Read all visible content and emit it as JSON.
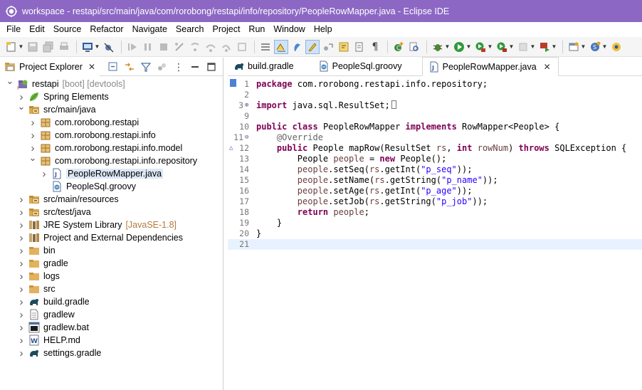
{
  "window": {
    "title": "workspace - restapi/src/main/java/com/rorobong/restapi/info/repository/PeopleRowMapper.java - Eclipse IDE"
  },
  "menu": [
    "File",
    "Edit",
    "Source",
    "Refactor",
    "Navigate",
    "Search",
    "Project",
    "Run",
    "Window",
    "Help"
  ],
  "explorer": {
    "tab_label": "Project Explorer",
    "close": "✕",
    "tree": [
      {
        "label": "restapi",
        "deco": "[boot] [devtools]",
        "icon": "project-icon",
        "indent": 0,
        "expand": "open"
      },
      {
        "label": "Spring Elements",
        "icon": "spring-leaf-icon",
        "indent": 1,
        "expand": "closed"
      },
      {
        "label": "src/main/java",
        "icon": "source-folder-icon",
        "indent": 1,
        "expand": "open"
      },
      {
        "label": "com.rorobong.restapi",
        "icon": "package-icon",
        "indent": 2,
        "expand": "closed"
      },
      {
        "label": "com.rorobong.restapi.info",
        "icon": "package-icon",
        "indent": 2,
        "expand": "closed"
      },
      {
        "label": "com.rorobong.restapi.info.model",
        "icon": "package-icon",
        "indent": 2,
        "expand": "closed"
      },
      {
        "label": "com.rorobong.restapi.info.repository",
        "icon": "package-icon",
        "indent": 2,
        "expand": "open"
      },
      {
        "label": "PeopleRowMapper.java",
        "icon": "java-file-icon",
        "indent": 3,
        "expand": "closed",
        "selected": true
      },
      {
        "label": "PeopleSql.groovy",
        "icon": "groovy-file-icon",
        "indent": 3,
        "expand": "none"
      },
      {
        "label": "src/main/resources",
        "icon": "source-folder-icon",
        "indent": 1,
        "expand": "closed"
      },
      {
        "label": "src/test/java",
        "icon": "source-folder-icon",
        "indent": 1,
        "expand": "closed"
      },
      {
        "label": "JRE System Library",
        "deco2": "[JavaSE-1.8]",
        "icon": "library-icon",
        "indent": 1,
        "expand": "closed"
      },
      {
        "label": "Project and External Dependencies",
        "icon": "library-icon",
        "indent": 1,
        "expand": "closed"
      },
      {
        "label": "bin",
        "icon": "folder-icon",
        "indent": 1,
        "expand": "closed"
      },
      {
        "label": "gradle",
        "icon": "folder-icon",
        "indent": 1,
        "expand": "closed"
      },
      {
        "label": "logs",
        "icon": "folder-icon",
        "indent": 1,
        "expand": "closed"
      },
      {
        "label": "src",
        "icon": "folder-icon",
        "indent": 1,
        "expand": "closed"
      },
      {
        "label": "build.gradle",
        "icon": "gradle-elephant-icon",
        "indent": 1,
        "expand": "closed"
      },
      {
        "label": "gradlew",
        "icon": "text-file-icon",
        "indent": 1,
        "expand": "closed"
      },
      {
        "label": "gradlew.bat",
        "icon": "bat-file-icon",
        "indent": 1,
        "expand": "closed"
      },
      {
        "label": "HELP.md",
        "icon": "markdown-file-icon",
        "indent": 1,
        "expand": "closed"
      },
      {
        "label": "settings.gradle",
        "icon": "gradle-elephant-icon",
        "indent": 1,
        "expand": "closed"
      }
    ]
  },
  "editor": {
    "tabs": [
      {
        "label": "build.gradle",
        "icon": "gradle-elephant-icon",
        "active": false
      },
      {
        "label": "PeopleSql.groovy",
        "icon": "groovy-file-icon",
        "active": false
      },
      {
        "label": "PeopleRowMapper.java",
        "icon": "java-file-icon",
        "active": true,
        "close": "✕"
      }
    ],
    "lines": [
      {
        "n": "1",
        "code": "package com.rorobong.restapi.info.repository;"
      },
      {
        "n": "2",
        "code": ""
      },
      {
        "n": "3",
        "code": "import java.sql.ResultSet;",
        "fold": "⊕"
      },
      {
        "n": "9",
        "code": ""
      },
      {
        "n": "10",
        "code": "public class PeopleRowMapper implements RowMapper<People> {"
      },
      {
        "n": "11",
        "code": "    @Override",
        "fold": "⊖"
      },
      {
        "n": "12",
        "code": "    public People mapRow(ResultSet rs, int rowNum) throws SQLException {",
        "over": "△"
      },
      {
        "n": "13",
        "code": "        People people = new People();"
      },
      {
        "n": "14",
        "code": "        people.setSeq(rs.getInt(\"p_seq\"));"
      },
      {
        "n": "15",
        "code": "        people.setName(rs.getString(\"p_name\"));"
      },
      {
        "n": "16",
        "code": "        people.setAge(rs.getInt(\"p_age\"));"
      },
      {
        "n": "17",
        "code": "        people.setJob(rs.getString(\"p_job\"));"
      },
      {
        "n": "18",
        "code": "        return people;"
      },
      {
        "n": "19",
        "code": "    }"
      },
      {
        "n": "20",
        "code": "}"
      },
      {
        "n": "21",
        "code": "",
        "current": true
      }
    ]
  },
  "colors": {
    "titlebar": "#8c68c4",
    "keyword": "#7f0055",
    "string": "#2a00ff",
    "annotation": "#646464",
    "local_var": "#6a3e3e",
    "current_line": "#e8f2fe",
    "selection": "#dde8f6"
  }
}
